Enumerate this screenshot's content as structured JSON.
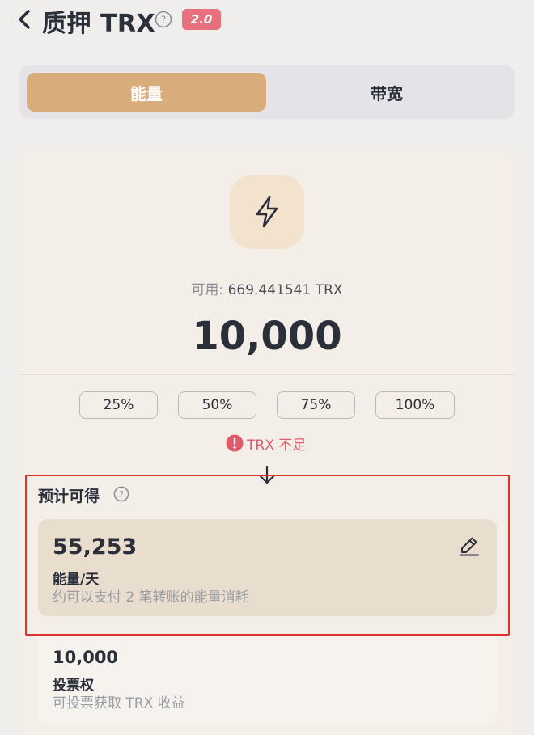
{
  "header": {
    "title": "质押 TRX",
    "version": "2.0"
  },
  "tabs": [
    {
      "label": "能量",
      "active": true
    },
    {
      "label": "带宽",
      "active": false
    }
  ],
  "stake": {
    "available_label": "可用:",
    "available_value": "669.441541 TRX",
    "amount": "10,000",
    "percent_options": [
      "25%",
      "50%",
      "75%",
      "100%"
    ],
    "warning": "TRX 不足"
  },
  "estimate": {
    "title": "预计可得",
    "energy": {
      "value": "55,253",
      "unit": "能量/天",
      "description": "约可以支付 2 笔转账的能量消耗"
    },
    "votes": {
      "value": "10,000",
      "unit": "投票权",
      "description": "可投票获取 TRX 收益"
    }
  },
  "colors": {
    "accent": "#d9ac7c",
    "badge": "#e8707d",
    "warning": "#e05a6a",
    "highlight_border": "#e0312a"
  },
  "icons": [
    "chevron-left-icon",
    "help-icon",
    "lightning-icon",
    "alert-icon",
    "arrow-down-icon",
    "edit-icon"
  ]
}
